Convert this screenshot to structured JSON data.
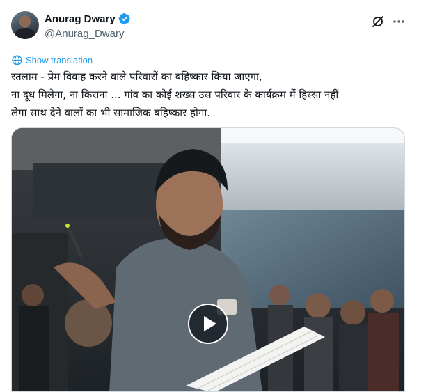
{
  "author": {
    "display_name": "Anurag Dwary",
    "handle": "@Anurag_Dwary",
    "verified": true
  },
  "actions": {
    "translation_label": "Show translation",
    "icons": [
      "grok-icon",
      "more-icon",
      "translate-icon",
      "verified-icon",
      "play-icon"
    ]
  },
  "tweet": {
    "text": "रतलाम - प्रेम विवाह करने वाले परिवारों का बहिष्कार किया जाएगा,\nना दूध मिलेगा, ना किराना ... गांव का कोई शख्स उस परिवार के कार्यक्रम में हिस्सा नहीं\nलेगा साथ देने वालों का भी सामाजिक बहिष्कार  होगा."
  },
  "media": {
    "type": "video"
  },
  "colors": {
    "accent": "#1d9bf0",
    "secondary_text": "#536471",
    "primary_text": "#0f1419",
    "border": "#eff3f4"
  }
}
